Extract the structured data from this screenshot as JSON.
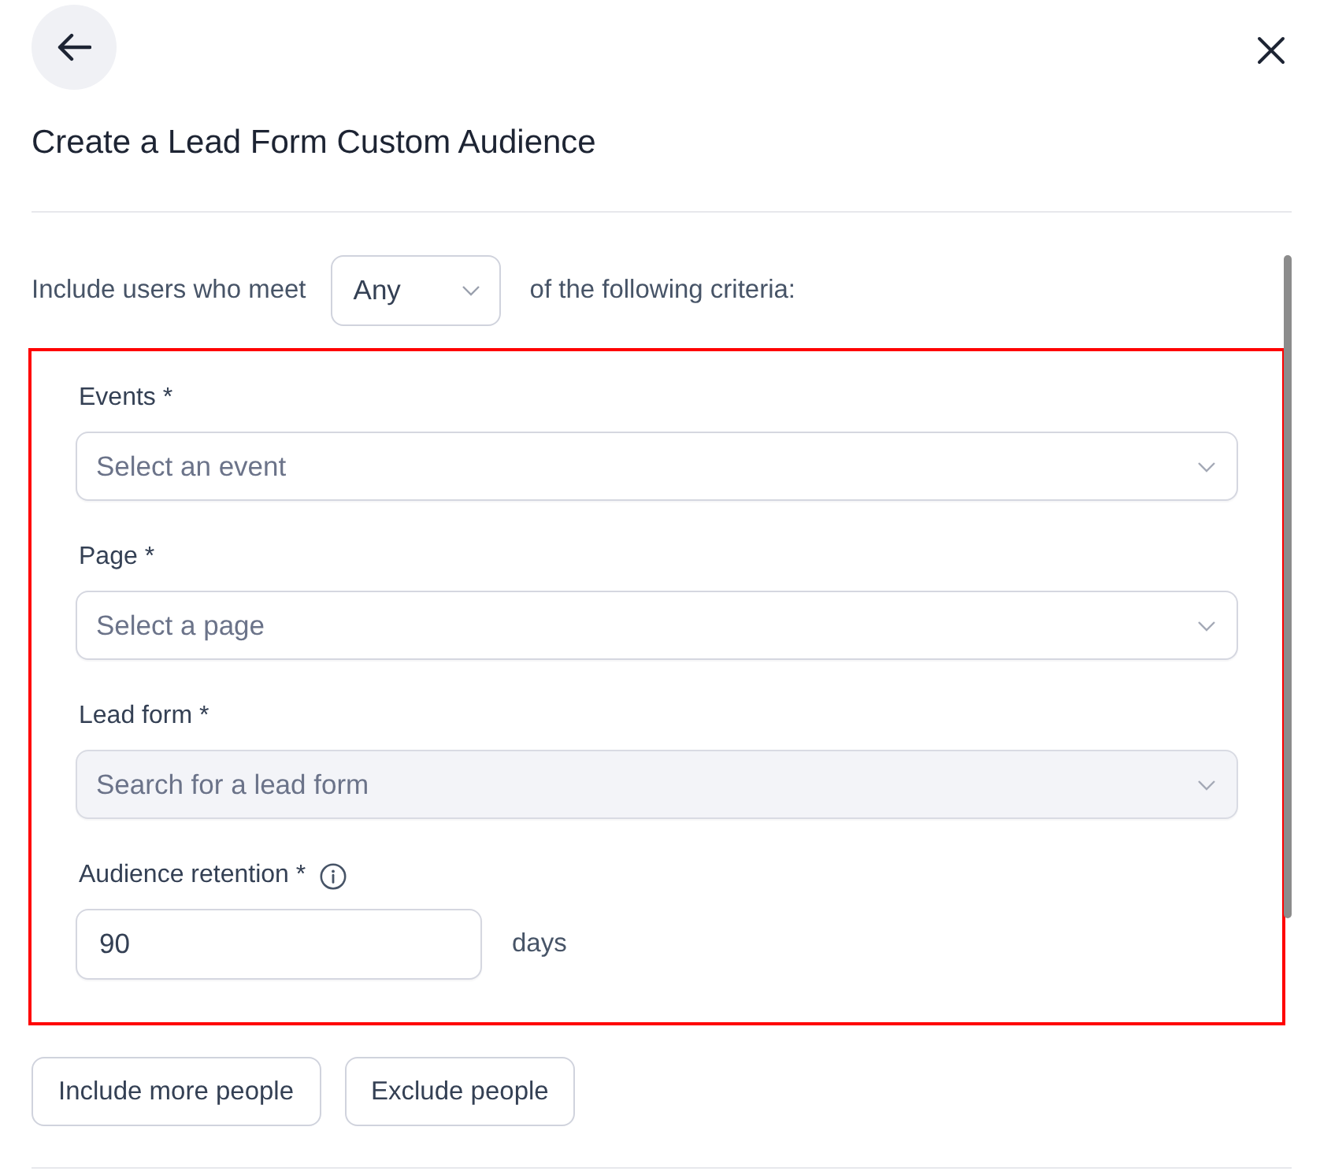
{
  "title": "Create a Lead Form Custom Audience",
  "match_row": {
    "prefix": "Include users who meet",
    "dropdown": {
      "value": "Any"
    },
    "suffix": "of the following criteria:"
  },
  "criteria": {
    "highlighted": true,
    "fields": [
      {
        "kind": "select",
        "label": "Events *",
        "info": false,
        "placeholder": "Select an event",
        "disabled": false
      },
      {
        "kind": "select",
        "label": "Page *",
        "info": false,
        "placeholder": "Select a page",
        "disabled": false
      },
      {
        "kind": "select",
        "label": "Lead form *",
        "info": false,
        "placeholder": "Search for a lead form",
        "disabled": true
      },
      {
        "kind": "number",
        "label": "Audience retention *",
        "info": true,
        "value": "90",
        "unit": "days",
        "disabled": false
      }
    ]
  },
  "buttons": [
    "Include more people",
    "Exclude people"
  ]
}
